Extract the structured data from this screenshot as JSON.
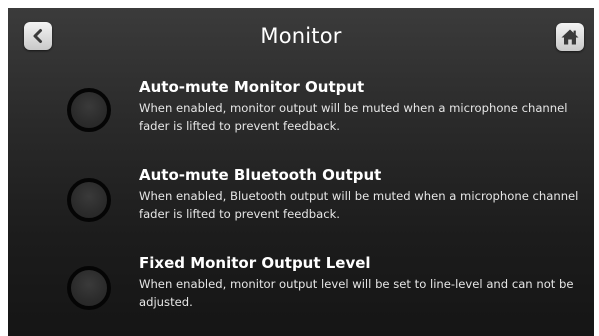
{
  "header": {
    "title": "Monitor",
    "back_button": {
      "icon": "chevron-left-icon"
    },
    "home_button": {
      "icon": "home-icon"
    }
  },
  "settings": [
    {
      "title": "Auto-mute Monitor Output",
      "description": "When enabled, monitor output will be muted when a microphone channel fader is lifted to prevent feedback.",
      "enabled": false
    },
    {
      "title": "Auto-mute Bluetooth Output",
      "description": "When enabled, Bluetooth output will be muted when a microphone channel fader is lifted to prevent feedback.",
      "enabled": false
    },
    {
      "title": "Fixed Monitor Output Level",
      "description": "When enabled, monitor output level will be set to line-level and can not be adjusted.",
      "enabled": false
    }
  ],
  "colors": {
    "background_top": "#3b3b3b",
    "background_bottom": "#151515",
    "text": "#ffffff",
    "button": "#e0e0e0",
    "icon": "#3a3a3a"
  }
}
